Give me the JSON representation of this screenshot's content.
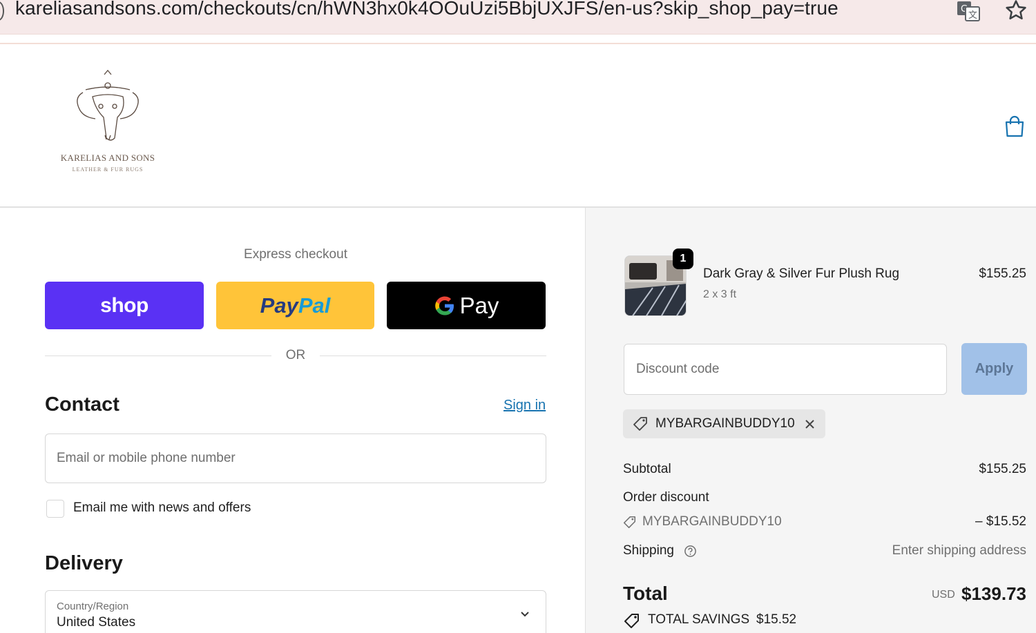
{
  "browser": {
    "url": "kareliasandsons.com/checkouts/cn/hWN3hx0k4OOuUzi5BbjUXJFS/en-us?skip_shop_pay=true",
    "icons": [
      "translate-icon",
      "star-icon"
    ]
  },
  "header": {
    "logo_name": "KARELIAS AND SONS",
    "logo_sub": "LEATHER & FUR RUGS",
    "cart_icon": "shopping-bag-icon"
  },
  "express": {
    "label": "Express checkout",
    "shop_label": "shop",
    "paypal_part1": "Pay",
    "paypal_part2": "Pal",
    "gpay_label": "Pay",
    "or_label": "OR",
    "colors": {
      "shop": "#5a31f4",
      "paypal": "#ffc439",
      "gpay": "#000000"
    }
  },
  "contact": {
    "title": "Contact",
    "signin": "Sign in",
    "email_placeholder": "Email or mobile phone number",
    "news_checkbox_label": "Email me with news and offers",
    "news_checked": false
  },
  "delivery": {
    "title": "Delivery",
    "country_label": "Country/Region",
    "country_value": "United States"
  },
  "summary": {
    "item": {
      "quantity": "1",
      "name": "Dark Gray & Silver Fur Plush Rug",
      "variant": "2 x 3 ft",
      "price": "$155.25"
    },
    "discount_placeholder": "Discount code",
    "apply_label": "Apply",
    "applied_code": "MYBARGAINBUDDY10",
    "subtotal_label": "Subtotal",
    "subtotal_value": "$155.25",
    "order_discount_label": "Order discount",
    "discount_code": "MYBARGAINBUDDY10",
    "discount_value": "– $15.52",
    "shipping_label": "Shipping",
    "shipping_value": "Enter shipping address",
    "total_label": "Total",
    "total_currency": "USD",
    "total_value": "$139.73",
    "savings_label": "TOTAL SAVINGS",
    "savings_value": "$15.52",
    "accent_color": "#1773b0"
  }
}
